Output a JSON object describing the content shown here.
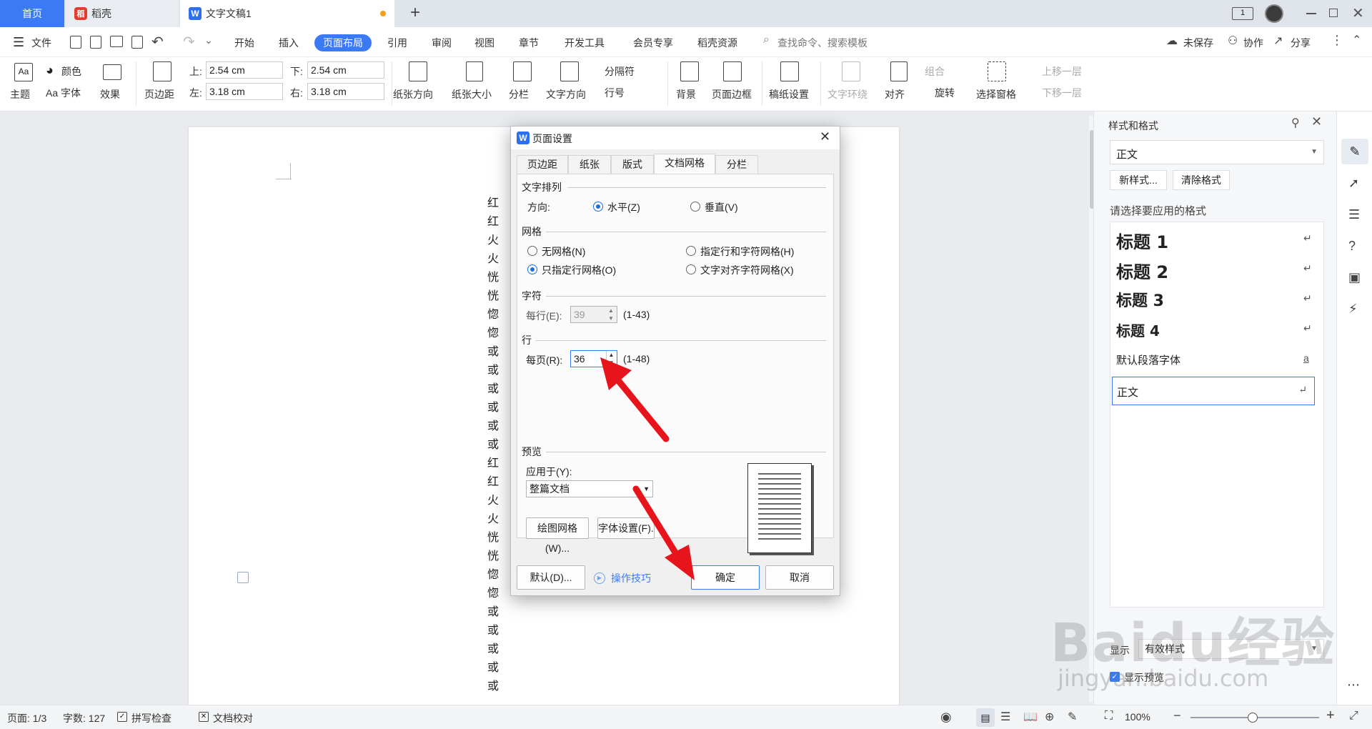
{
  "tabs": {
    "home": "首页",
    "docer": "稻壳",
    "doc": "文字文稿1",
    "add": "+"
  },
  "menubar": {
    "file": "文件",
    "items": [
      "开始",
      "插入",
      "页面布局",
      "引用",
      "审阅",
      "视图",
      "章节",
      "开发工具",
      "会员专享",
      "稻壳资源"
    ],
    "search": "查找命令、搜索模板",
    "unsaved": "未保存",
    "collab": "协作",
    "share": "分享"
  },
  "ribbon": {
    "theme": "主题",
    "color": "颜色",
    "font": "Aa 字体",
    "effect": "效果",
    "margin": "页边距",
    "top_label": "上:",
    "top_value": "2.54 cm",
    "bottom_label": "下:",
    "bottom_value": "2.54 cm",
    "left_label": "左:",
    "left_value": "3.18 cm",
    "right_label": "右:",
    "right_value": "3.18 cm",
    "orientation": "纸张方向",
    "size": "纸张大小",
    "columns": "分栏",
    "text_dir": "文字方向",
    "breaks": "分隔符",
    "line_num": "行号",
    "background": "背景",
    "border": "页面边框",
    "grid_paper": "稿纸设置",
    "wrap": "文字环绕",
    "align": "对齐",
    "group": "组合",
    "rotate": "旋转",
    "select_pane": "选择窗格",
    "bring_fwd": "上移一层",
    "send_back": "下移一层"
  },
  "document": {
    "chars": [
      "红",
      "红",
      "火",
      "火",
      "恍",
      "恍",
      "惚",
      "惚",
      "或",
      "或",
      "或",
      "或",
      "或",
      "或",
      "红",
      "红",
      "火",
      "火",
      "恍",
      "恍",
      "惚",
      "惚",
      "或",
      "或",
      "或",
      "或",
      "或"
    ]
  },
  "rightpane": {
    "title": "样式和格式",
    "current_style": "正文",
    "new_style": "新样式...",
    "clear_format": "清除格式",
    "choose_label": "请选择要应用的格式",
    "styles": [
      "标题  1",
      "标题  2",
      "标题  3",
      "标题  4",
      "默认段落字体",
      "正文"
    ],
    "show_label": "显示",
    "show_value": "有效样式",
    "preview_check": "显示预览"
  },
  "dialog": {
    "title": "页面设置",
    "tabs": [
      "页边距",
      "纸张",
      "版式",
      "文档网格",
      "分栏"
    ],
    "text_arrange": "文字排列",
    "direction": "方向:",
    "horizontal": "水平(Z)",
    "vertical": "垂直(V)",
    "grid": "网格",
    "no_grid": "无网格(N)",
    "line_char_grid": "指定行和字符网格(H)",
    "line_grid": "只指定行网格(O)",
    "align_char_grid": "文字对齐字符网格(X)",
    "chars": "字符",
    "per_line": "每行(E):",
    "per_line_value": "39",
    "per_line_range": "(1-43)",
    "lines": "行",
    "per_page": "每页(R):",
    "per_page_value": "36",
    "per_page_range": "(1-48)",
    "preview": "预览",
    "apply_to": "应用于(Y):",
    "apply_value": "整篇文档",
    "draw_grid": "绘图网格(W)...",
    "font_settings": "字体设置(F)...",
    "default": "默认(D)...",
    "tips": "操作技巧",
    "ok": "确定",
    "cancel": "取消"
  },
  "statusbar": {
    "page": "页面: 1/3",
    "words": "字数: 127",
    "spell": "拼写检查",
    "proof": "文档校对",
    "zoom": "100%"
  },
  "watermark": {
    "brand": "Baidu经验",
    "url": "jingyan.baidu.com"
  },
  "colors": {
    "accent": "#3a7af5",
    "arrow": "#e8141b"
  }
}
